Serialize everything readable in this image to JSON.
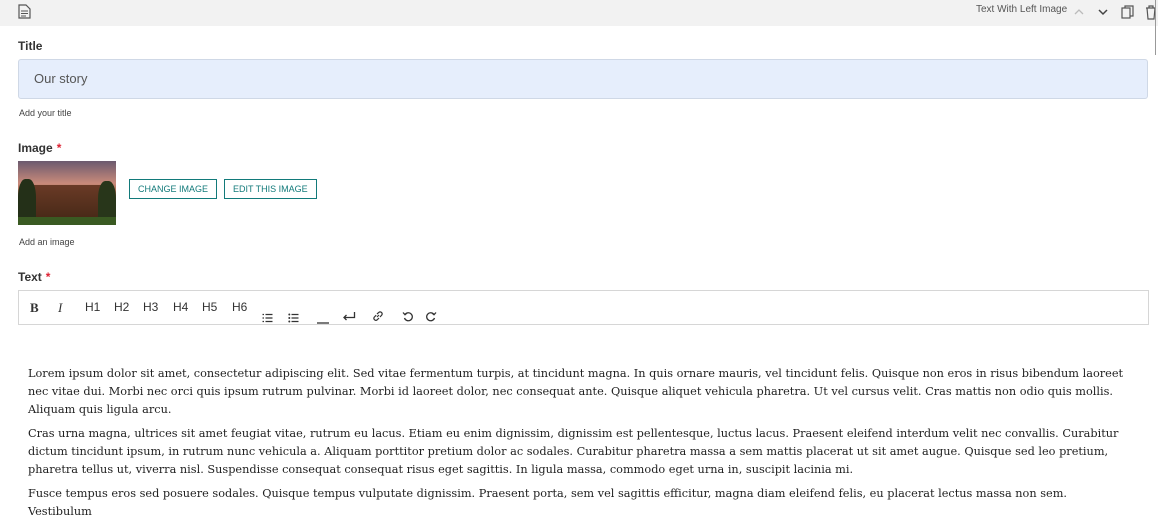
{
  "topbar": {
    "block_type": "Text With Left Image",
    "icons": [
      "document-icon",
      "chevron-up-icon",
      "chevron-down-icon",
      "duplicate-icon",
      "delete-icon"
    ]
  },
  "title_field": {
    "label": "Title",
    "value": "Our story",
    "helper": "Add your title"
  },
  "image_field": {
    "label": "Image",
    "required": "*",
    "change_button": "CHANGE IMAGE",
    "edit_button": "EDIT THIS IMAGE",
    "helper": "Add an image"
  },
  "text_field": {
    "label": "Text",
    "required": "*",
    "toolbar": {
      "bold": "B",
      "italic": "I",
      "h1": "H1",
      "h2": "H2",
      "h3": "H3",
      "h4": "H4",
      "h5": "H5",
      "h6": "H6",
      "icons": [
        "ordered-list-icon",
        "bullet-list-icon",
        "horizontal-rule-icon",
        "line-break-icon",
        "link-icon",
        "undo-icon",
        "redo-icon"
      ]
    },
    "paragraphs": [
      "Lorem ipsum dolor sit amet, consectetur adipiscing elit. Sed vitae fermentum turpis, at tincidunt magna. In quis ornare mauris, vel tincidunt felis. Quisque non eros in risus bibendum laoreet nec vitae dui. Morbi nec orci quis ipsum rutrum pulvinar. Morbi id laoreet dolor, nec consequat ante. Quisque aliquet vehicula pharetra. Ut vel cursus velit. Cras mattis non odio quis mollis. Aliquam quis ligula arcu.",
      "Cras urna magna, ultrices sit amet feugiat vitae, rutrum eu lacus. Etiam eu enim dignissim, dignissim est pellentesque, luctus lacus. Praesent eleifend interdum velit nec convallis. Curabitur dictum tincidunt ipsum, in rutrum nunc vehicula a. Aliquam porttitor pretium dolor ac sodales. Curabitur pharetra massa a sem mattis placerat ut sit amet augue. Quisque sed leo pretium, pharetra tellus ut, viverra nisl. Suspendisse consequat consequat risus eget sagittis. In ligula massa, commodo eget urna in, suscipit lacinia mi.",
      "Fusce tempus eros sed posuere sodales. Quisque tempus vulputate dignissim. Praesent porta, sem vel sagittis efficitur, magna diam eleifend felis, eu placerat lectus massa non sem. Vestibulum"
    ]
  },
  "colors": {
    "accent": "#127a7a",
    "required": "#dd2233",
    "input_bg": "#e6eefc",
    "topbar_bg": "#f2f2f2"
  }
}
